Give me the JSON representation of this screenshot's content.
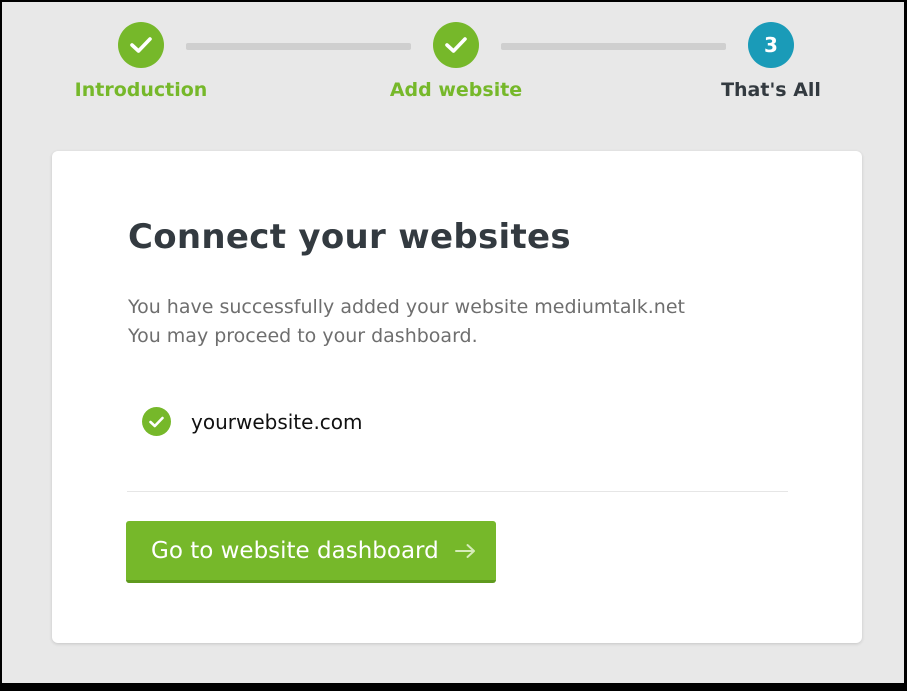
{
  "colors": {
    "success_green": "#76b82a",
    "current_teal": "#1a9bb8",
    "heading_dark": "#333a40",
    "body_gray": "#6e6e6e",
    "page_background": "#e8e8e8"
  },
  "stepper": {
    "steps": [
      {
        "label": "Introduction",
        "state": "completed",
        "icon": "check-icon"
      },
      {
        "label": "Add website",
        "state": "completed",
        "icon": "check-icon"
      },
      {
        "label": "That's All",
        "state": "current",
        "number": "3"
      }
    ]
  },
  "card": {
    "title": "Connect your websites",
    "message_line1": "You have successfully added your website mediumtalk.net",
    "message_line2": "You may proceed to your dashboard.",
    "website": {
      "name": "yourwebsite.com",
      "status_icon": "check-circle-icon"
    },
    "button": {
      "label": "Go to website dashboard",
      "icon": "arrow-right-icon"
    }
  }
}
